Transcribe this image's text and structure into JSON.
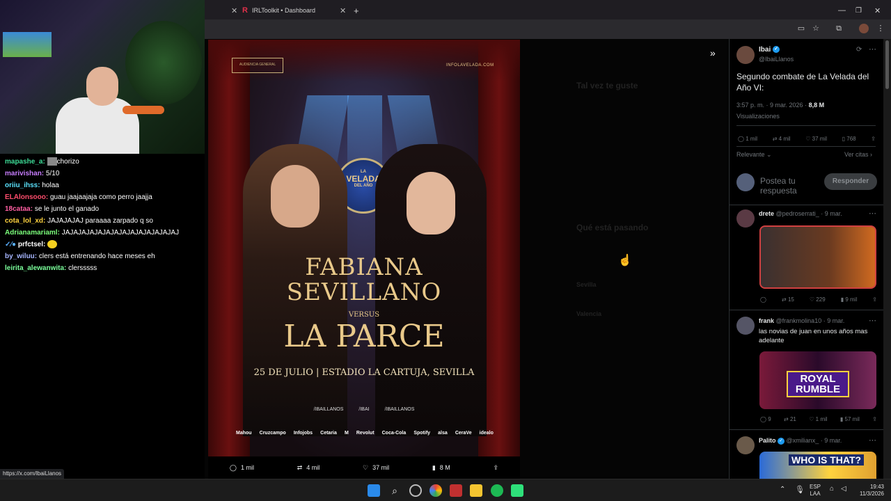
{
  "browser": {
    "tab_title": "IRLToolkit • Dashboard",
    "new_tab": "+",
    "status_url": "https://x.com/IbaiLlanos"
  },
  "chat": [
    {
      "user": "mapashe_a:",
      "color": "#3ddc97",
      "text": "chorizo"
    },
    {
      "user": "marivishan:",
      "color": "#c77dff",
      "text": "5/10"
    },
    {
      "user": "oriiu_ihss:",
      "color": "#5be3ff",
      "text": "holaa"
    },
    {
      "user": "ELAlonsooo:",
      "color": "#ff4d6d",
      "text": "guau jaajaajaja como perro jaajja"
    },
    {
      "user": "18cataa:",
      "color": "#ff5fa2",
      "text": "se le junto el ganado"
    },
    {
      "user": "cota_lol_xd:",
      "color": "#ffd23f",
      "text": "JAJAJAJAJ paraaaa zarpado q so"
    },
    {
      "user": "Adrianamariaml:",
      "color": "#7bff7b",
      "text": "JAJAJAJAJAJAJAJAJAJAJAJAJAJAJ"
    },
    {
      "user": "prfctsel:",
      "color": "#ffffff",
      "text": ""
    },
    {
      "user": "by_wiluu:",
      "color": "#a6b5ff",
      "text": "clers está entrenando hace meses eh"
    },
    {
      "user": "leirita_alewanwita:",
      "color": "#7bff9b",
      "text": "clersssss"
    }
  ],
  "poster": {
    "producer": "AUDIENCIA GENERAL",
    "website": "INFOLAVELADA.COM",
    "badge_top": "LA",
    "badge_main": "VELADA",
    "badge_bottom": "DEL AÑO",
    "fighter1_first": "FABIANA",
    "fighter1_last": "SEVILLANO",
    "versus": "VERSUS",
    "fighter2": "LA PARCE",
    "event": "25 DE JULIO | ESTADIO LA CARTUJA, SEVILLA",
    "socials": [
      "/IBAILLANOS",
      "/IBAI",
      "/IBAILLANOS"
    ],
    "sponsors": [
      "Mahou",
      "Cruzcampo",
      "Infojobs",
      "Cetaria",
      "M",
      "Revolut",
      "Coca-Cola",
      "Spotify",
      "alsa",
      "CeraVe",
      "idealo"
    ]
  },
  "media_bar": {
    "replies": "1 mil",
    "reposts": "4 mil",
    "likes": "37 mil",
    "views": "8 M"
  },
  "main_tweet": {
    "name": "Ibai",
    "handle": "@IbaiLlanos",
    "text": "Segundo combate de La Velada del Año VI:",
    "time": "3:57 p. m. · 9 mar. 2026 ·",
    "views": "8,8 M",
    "views_label": "Visualizaciones",
    "replies": "1 mil",
    "reposts": "4 mil",
    "likes": "37 mil",
    "bookmarks": "768",
    "sort": "Relevante",
    "quotes": "Ver citas",
    "reply_placeholder": "Postea tu respuesta",
    "reply_button": "Responder"
  },
  "replies": [
    {
      "name": "drete",
      "handle": "@pedroserrati_ · 9 mar.",
      "text": "",
      "c": "",
      "r": "15",
      "l": "229",
      "v": "9 mil"
    },
    {
      "name": "frank",
      "handle": "@frankmolina10 · 9 mar.",
      "text": "las novias de juan en unos años mas adelante",
      "c": "9",
      "r": "21",
      "l": "1 mil",
      "v": "57 mil",
      "image_text": "ROYAL RUMBLE"
    },
    {
      "name": "Palito",
      "handle": "@xmilianx_ · 9 mar.",
      "text": "",
      "image_text": "WHO IS THAT?"
    }
  ],
  "background_page": {
    "section1": "Tal vez te guste",
    "section2": "Qué está pasando",
    "trend1": "Sevilla",
    "trend2": "Valencia"
  },
  "taskbar": {
    "lang": "ESP",
    "layout": "LAA",
    "time": "19:43",
    "date": "11/3/2026"
  },
  "colors": {
    "accent": "#1d9bf0",
    "gold": "#e9c98a"
  }
}
